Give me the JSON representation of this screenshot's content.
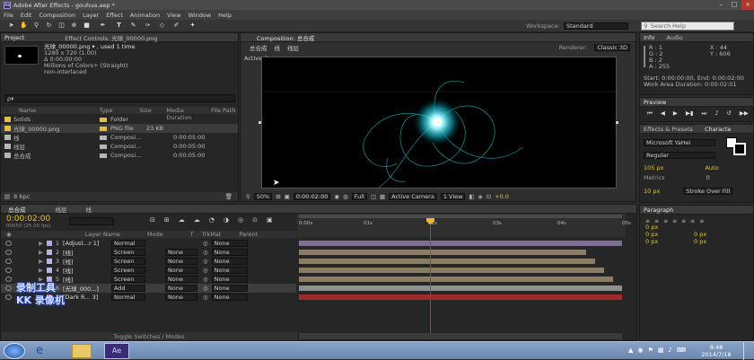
{
  "app": {
    "title": "Adobe After Effects - gouhua.aep *"
  },
  "menu": [
    "File",
    "Edit",
    "Composition",
    "Layer",
    "Effect",
    "Animation",
    "View",
    "Window",
    "Help"
  ],
  "toolbar": {
    "workspace_label": "Workspace:",
    "workspace_value": "Standard",
    "search_placeholder": "Search Help"
  },
  "project": {
    "tab_project": "Project",
    "tab_effect": "Effect Controls: 光球_00000.png",
    "file_name": "光球_00000.png ▾ , used 1 time",
    "dims": "1280 x 720 (1.00)",
    "duration": "Δ 0:00:00:00",
    "color": "Millions of Colors+ (Straight)",
    "interlace": "non-interlaced",
    "search": "ρ▾",
    "columns": [
      "Name",
      "Type",
      "Size",
      "Media Duration",
      "File Path"
    ],
    "items": [
      {
        "name": "Solids",
        "type": "Folder",
        "size": "",
        "duration": "",
        "color": "#e2c13b"
      },
      {
        "name": "光球_00000.png",
        "type": "PNG file",
        "size": "23 KB",
        "duration": "",
        "color": "#e2c13b"
      },
      {
        "name": "线",
        "type": "Composi...",
        "size": "",
        "duration": "0:00:05:00",
        "color": "#b6b6b6"
      },
      {
        "name": "线层",
        "type": "Composi...",
        "size": "",
        "duration": "0:00:05:00",
        "color": "#b6b6b6"
      },
      {
        "name": "总合成",
        "type": "Composi...",
        "size": "",
        "duration": "0:00:05:00",
        "color": "#b6b6b6"
      }
    ],
    "bpc": "8 bpc"
  },
  "comp": {
    "panel_title": "Composition: 总合成",
    "breadcrumbs": [
      "总合成",
      "线",
      "线层"
    ],
    "renderer_label": "Renderer:",
    "renderer_value": "Classic 3D",
    "active_camera": "Active Camera",
    "zoom": "50%",
    "time": "0:00:02:00",
    "resolution": "Full",
    "camera": "Active Camera",
    "view": "1 View",
    "offset": "+0.0"
  },
  "info": {
    "tab_info": "Info",
    "tab_audio": "Audio",
    "r": "R : 1",
    "g": "G : 2",
    "b": "B : 2",
    "a": "A : 255",
    "x": "X : 44",
    "y": "Y : 606",
    "start": "Start: 0:00:00:00, End: 0:00:02:00",
    "work": "Work Area Duration: 0:00:02:01"
  },
  "preview": {
    "title": "Preview"
  },
  "effects": {
    "tab": "Effects & Presets",
    "char_tab": "Characte"
  },
  "character": {
    "font": "Microsoft YaHei",
    "style": "Regular",
    "size": "105 px",
    "leading": "Auto",
    "tracking": "Metrics",
    "kerning": "0",
    "stroke": "10 px",
    "stroke_type": "Stroke Over Fill"
  },
  "paragraph": {
    "title": "Paragraph",
    "v1": "0 px",
    "v2": "0 px",
    "v3": "0 px",
    "v4": "0 px",
    "v5": "0 px"
  },
  "timeline": {
    "tabs": [
      "总合成",
      "线层",
      "线"
    ],
    "current_time": "0:00:02:00",
    "frames": "00050 (25.00 fps)",
    "cols": {
      "name": "Layer Name",
      "mode": "Mode",
      "t": "T",
      "trkmat": "TrkMat",
      "parent": "Parent"
    },
    "ruler": [
      "0:00s",
      "01s",
      "02s",
      "03s",
      "04s",
      "05s"
    ],
    "layers": [
      {
        "num": "1",
        "name": "[Adjust...r 1]",
        "mode": "Normal",
        "trk": "",
        "parent": "None",
        "color": "#b9a7d9",
        "bar": "#7e6f95"
      },
      {
        "num": "2",
        "name": "[线]",
        "mode": "Screen",
        "trk": "None",
        "parent": "None",
        "color": "#b5b5e0",
        "bar": "#8b7c66"
      },
      {
        "num": "3",
        "name": "[线]",
        "mode": "Screen",
        "trk": "None",
        "parent": "None",
        "color": "#b5b5e0",
        "bar": "#8b7c66"
      },
      {
        "num": "4",
        "name": "[线]",
        "mode": "Screen",
        "trk": "None",
        "parent": "None",
        "color": "#b5b5e0",
        "bar": "#8b7c66"
      },
      {
        "num": "5",
        "name": "[线]",
        "mode": "Screen",
        "trk": "None",
        "parent": "None",
        "color": "#b5b5e0",
        "bar": "#8b7c66"
      },
      {
        "num": "6",
        "name": "[光球_000...]",
        "mode": "Add",
        "trk": "None",
        "parent": "None",
        "color": "#b5b5e0",
        "bar": "#8f8f8f"
      },
      {
        "num": "7",
        "name": "[Dark R... 3]",
        "mode": "Normal",
        "trk": "None",
        "parent": "None",
        "color": "#c43a3a",
        "bar": "#9e2b2b"
      }
    ],
    "footer": "Toggle Switches / Modes"
  },
  "watermark": {
    "line1": "录制工具",
    "line2": "KK 录像机"
  },
  "taskbar": {
    "clock": "8:48",
    "date": "2014/7/18",
    "ae_label": "Ae"
  }
}
